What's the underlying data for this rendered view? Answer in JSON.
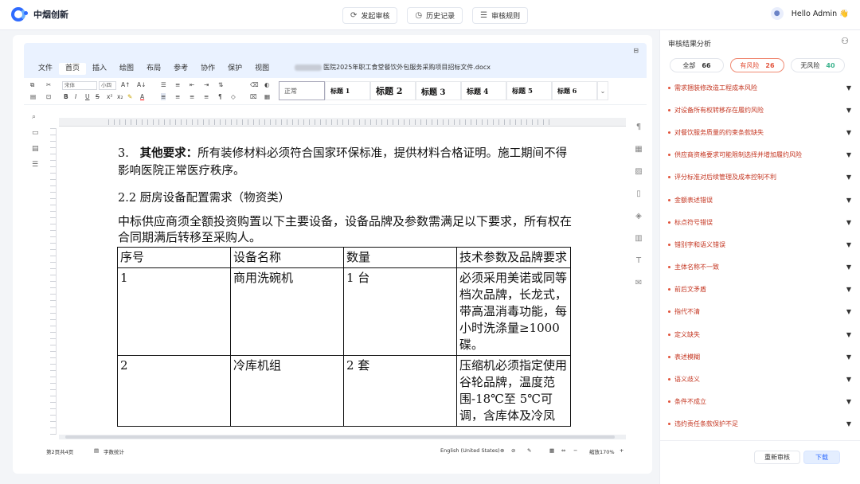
{
  "app": {
    "brand": "中烟创新"
  },
  "topnav": [
    {
      "icon": "refresh-icon",
      "label": "发起审核"
    },
    {
      "icon": "clock-icon",
      "label": "历史记录"
    },
    {
      "icon": "list-icon",
      "label": "审核规则"
    }
  ],
  "user": {
    "greeting": "Hello Admin",
    "emoji": "👋"
  },
  "editor": {
    "menus": [
      "文件",
      "首页",
      "插入",
      "绘图",
      "布局",
      "参考",
      "协作",
      "保护",
      "视图"
    ],
    "active_menu": "首页",
    "doc_title": "医院2025年职工食堂餐饮外包服务采购项目招标文件.docx",
    "font_name": "宋体",
    "font_size": "小四",
    "styles": [
      "正常",
      "标题 1",
      "标题 2",
      "标题 3",
      "标题 4",
      "标题 5",
      "标题 6"
    ],
    "content": {
      "item_num": "3.",
      "item_bold": "其他要求：",
      "item_text": "所有装修材料必须符合国家环保标准，提供材料合格证明。施工期间不得影响医院正常医疗秩序。",
      "heading": "2.2 厨房设备配置需求（物资类）",
      "para": "中标供应商须全额投资购置以下主要设备，设备品牌及参数需满足以下要求，所有权在合同期满后转移至采购人。",
      "table_headers": [
        "序号",
        "设备名称",
        "数量",
        "技术参数及品牌要求"
      ],
      "table_rows": [
        [
          "1",
          "商用洗碗机",
          "1 台",
          "必须采用美诺或同等档次品牌，长龙式，带高温消毒功能，每小时洗涤量≥1000 碟。"
        ],
        [
          "2",
          "冷库机组",
          "2 套",
          "压缩机必须指定使用谷轮品牌，温度范围-18℃至 5℃可调，含库体及冷凤"
        ]
      ]
    },
    "status": {
      "page": "第2页共4页",
      "word_count": "字数统计",
      "language": "English (United States)",
      "zoom": "缩放170%"
    }
  },
  "panel": {
    "title": "审核结果分析",
    "tabs": [
      {
        "label": "全部",
        "count": "66"
      },
      {
        "label": "有风险",
        "count": "26"
      },
      {
        "label": "无风险",
        "count": "40"
      }
    ],
    "active_tab": "有风险",
    "risks": [
      "需求捆装修改造工程成本风险",
      "对设备所有权转移存在履约风险",
      "对餐饮服务质量的约束条款缺失",
      "供应商资格要求可能限制选择并增加履约风险",
      "评分标准对后续管理及成本控制不利",
      "金额表述错误",
      "标点符号错误",
      "错别字和语义错误",
      "主体名称不一致",
      "前后文矛盾",
      "指代不清",
      "定义缺失",
      "表述模糊",
      "语义歧义",
      "条件不成立",
      "违约责任条款保护不足"
    ],
    "buttons": {
      "reaudit": "重新审核",
      "download": "下载"
    }
  },
  "colors": {
    "accent": "#2f6bff",
    "risk": "#e2523a",
    "norisk": "#3bb38d"
  }
}
